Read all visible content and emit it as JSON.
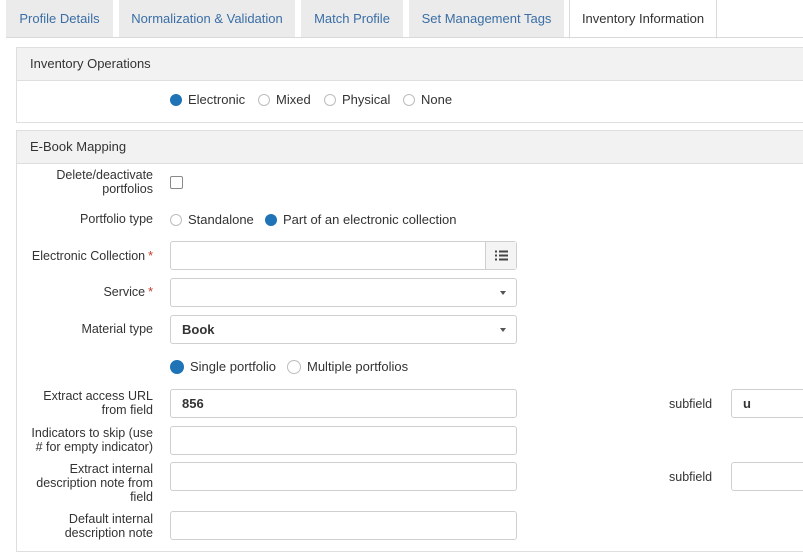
{
  "tabs": [
    {
      "label": "Profile Details"
    },
    {
      "label": "Normalization & Validation"
    },
    {
      "label": "Match Profile"
    },
    {
      "label": "Set Management Tags"
    },
    {
      "label": "Inventory Information"
    }
  ],
  "inventory_operations": {
    "title": "Inventory Operations",
    "options": [
      "Electronic",
      "Mixed",
      "Physical",
      "None"
    ],
    "selected": "Electronic"
  },
  "ebook_mapping": {
    "title": "E-Book Mapping",
    "delete_portfolios_label": "Delete/deactivate portfolios",
    "delete_portfolios_line1": "Delete/deactivate",
    "delete_portfolios_line2": "portfolios",
    "portfolio_type_label": "Portfolio type",
    "portfolio_type_options": [
      "Standalone",
      "Part of an electronic collection"
    ],
    "portfolio_type_selected": "Part of an electronic collection",
    "electronic_collection_label": "Electronic Collection",
    "electronic_collection_value": "",
    "service_label": "Service",
    "service_value": "",
    "material_type_label": "Material type",
    "material_type_value": "Book",
    "portfolio_count_options": [
      "Single portfolio",
      "Multiple portfolios"
    ],
    "portfolio_count_selected": "Single portfolio",
    "extract_url_line1": "Extract access URL",
    "extract_url_line2": "from field",
    "extract_url_value": "856",
    "subfield_label": "subfield",
    "extract_url_subfield": "u",
    "indicators_line1": "Indicators to skip (use",
    "indicators_line2": "# for empty indicator)",
    "indicators_value": "",
    "internal_note_line1": "Extract internal",
    "internal_note_line2": "description note from",
    "internal_note_line3": "field",
    "internal_note_value": "",
    "internal_note_subfield": "",
    "default_note_line1": "Default internal",
    "default_note_line2": "description note",
    "default_note_value": ""
  },
  "required_marker": "*",
  "accent_color": "#1f73b7",
  "icons": {
    "list": "list-icon",
    "dropdown": "chevron-down-icon"
  }
}
